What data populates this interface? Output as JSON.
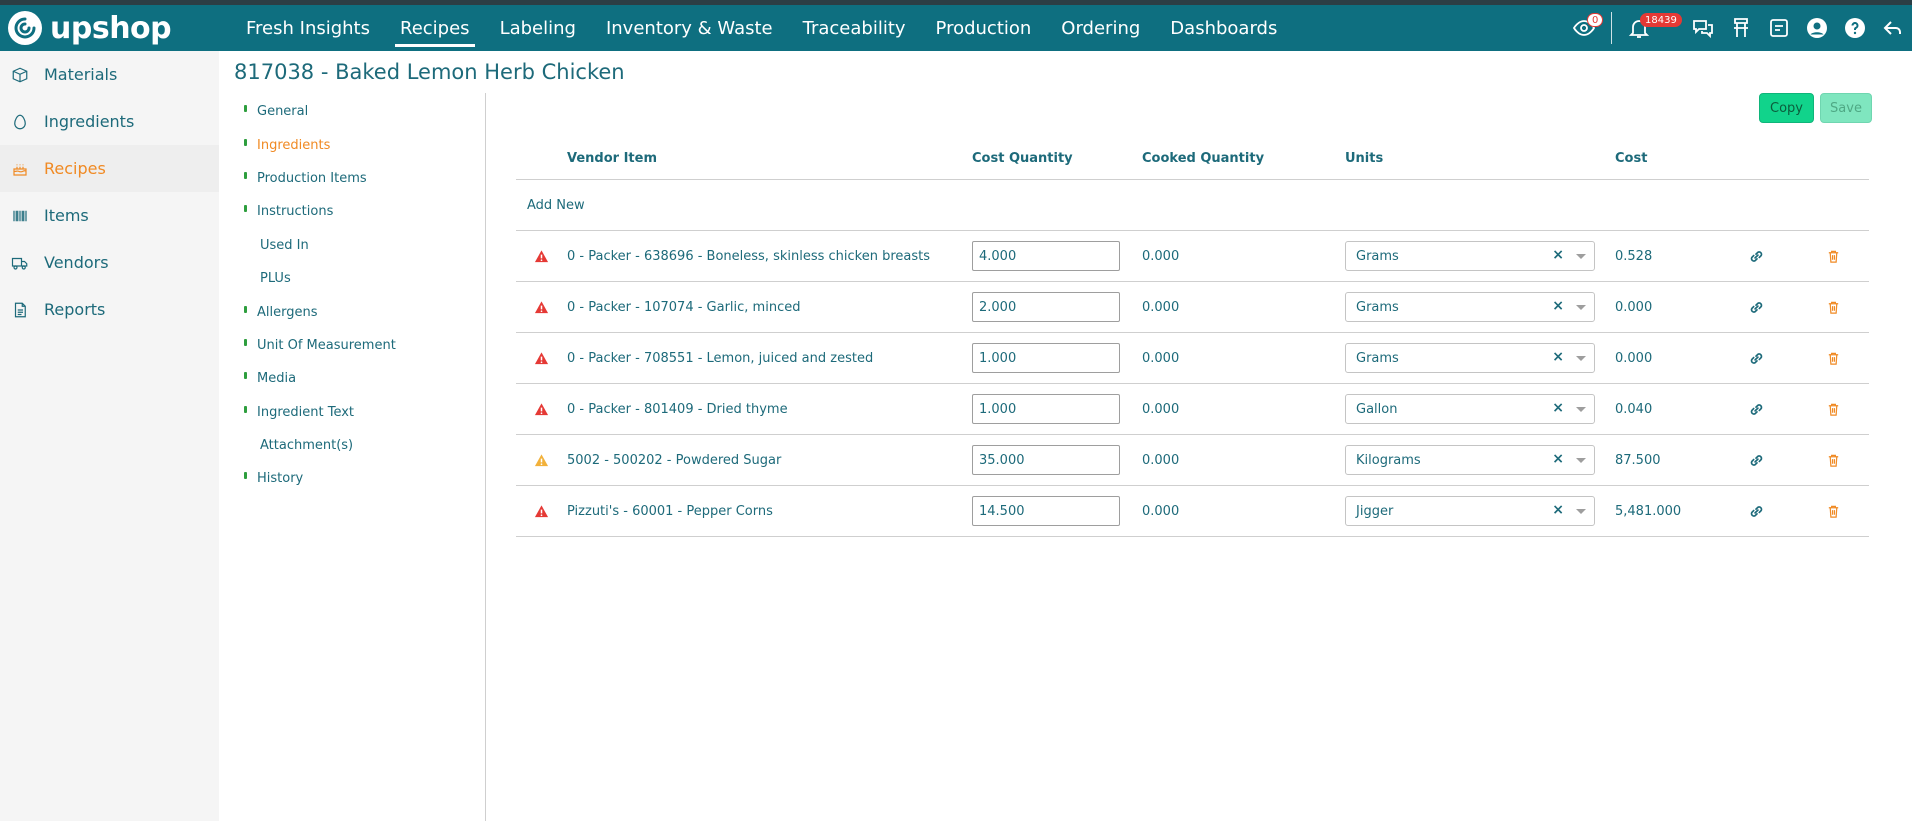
{
  "app": {
    "logo_text": "upshop",
    "nav": [
      {
        "label": "Fresh Insights"
      },
      {
        "label": "Recipes",
        "active": true
      },
      {
        "label": "Labeling"
      },
      {
        "label": "Inventory & Waste"
      },
      {
        "label": "Traceability"
      },
      {
        "label": "Production"
      },
      {
        "label": "Ordering"
      },
      {
        "label": "Dashboards"
      }
    ],
    "icons": {
      "eye_badge": "0",
      "bell_badge": "18439"
    },
    "colors": {
      "topbar": "#0e6f80",
      "accent": "#f08a24",
      "copy_button": "#11d38b",
      "error": "#e53935",
      "warning": "#f2b13a"
    }
  },
  "sidebar": {
    "items": [
      {
        "label": "Materials",
        "icon": "box-icon"
      },
      {
        "label": "Ingredients",
        "icon": "egg-icon"
      },
      {
        "label": "Recipes",
        "icon": "cake-icon",
        "active": true
      },
      {
        "label": "Items",
        "icon": "barcode-icon"
      },
      {
        "label": "Vendors",
        "icon": "truck-icon"
      },
      {
        "label": "Reports",
        "icon": "report-icon"
      }
    ]
  },
  "page": {
    "title": "817038 - Baked Lemon Herb Chicken",
    "subnav": [
      {
        "label": "General",
        "marked": true
      },
      {
        "label": "Ingredients",
        "marked": true,
        "active": true
      },
      {
        "label": "Production Items",
        "marked": true
      },
      {
        "label": "Instructions",
        "marked": true
      },
      {
        "label": "Used In",
        "marked": false
      },
      {
        "label": "PLUs",
        "marked": false
      },
      {
        "label": "Allergens",
        "marked": true
      },
      {
        "label": "Unit Of Measurement",
        "marked": true
      },
      {
        "label": "Media",
        "marked": true
      },
      {
        "label": "Ingredient Text",
        "marked": true
      },
      {
        "label": "Attachment(s)",
        "marked": false
      },
      {
        "label": "History",
        "marked": true
      }
    ],
    "buttons": {
      "copy": "Copy",
      "save": "Save"
    }
  },
  "grid": {
    "headers": {
      "vendor_item": "Vendor Item",
      "cost_quantity": "Cost Quantity",
      "cooked_quantity": "Cooked Quantity",
      "units": "Units",
      "cost": "Cost"
    },
    "add_new": "Add New",
    "rows": [
      {
        "status": "error",
        "vendor_item": "0 - Packer - 638696 - Boneless, skinless chicken breasts",
        "cost_quantity": "4.000",
        "cooked_quantity": "0.000",
        "units": "Grams",
        "cost": "0.528"
      },
      {
        "status": "error",
        "vendor_item": "0 - Packer - 107074 - Garlic, minced",
        "cost_quantity": "2.000",
        "cooked_quantity": "0.000",
        "units": "Grams",
        "cost": "0.000"
      },
      {
        "status": "error",
        "vendor_item": "0 - Packer - 708551 - Lemon, juiced and zested",
        "cost_quantity": "1.000",
        "cooked_quantity": "0.000",
        "units": "Grams",
        "cost": "0.000"
      },
      {
        "status": "error",
        "vendor_item": "0 - Packer - 801409 - Dried thyme",
        "cost_quantity": "1.000",
        "cooked_quantity": "0.000",
        "units": "Gallon",
        "cost": "0.040"
      },
      {
        "status": "warning",
        "vendor_item": "5002 - 500202 - Powdered Sugar",
        "cost_quantity": "35.000",
        "cooked_quantity": "0.000",
        "units": "Kilograms",
        "cost": "87.500"
      },
      {
        "status": "error",
        "vendor_item": "Pizzuti's - 60001 - Pepper Corns",
        "cost_quantity": "14.500",
        "cooked_quantity": "0.000",
        "units": "Jigger",
        "cost": "5,481.000"
      }
    ]
  }
}
